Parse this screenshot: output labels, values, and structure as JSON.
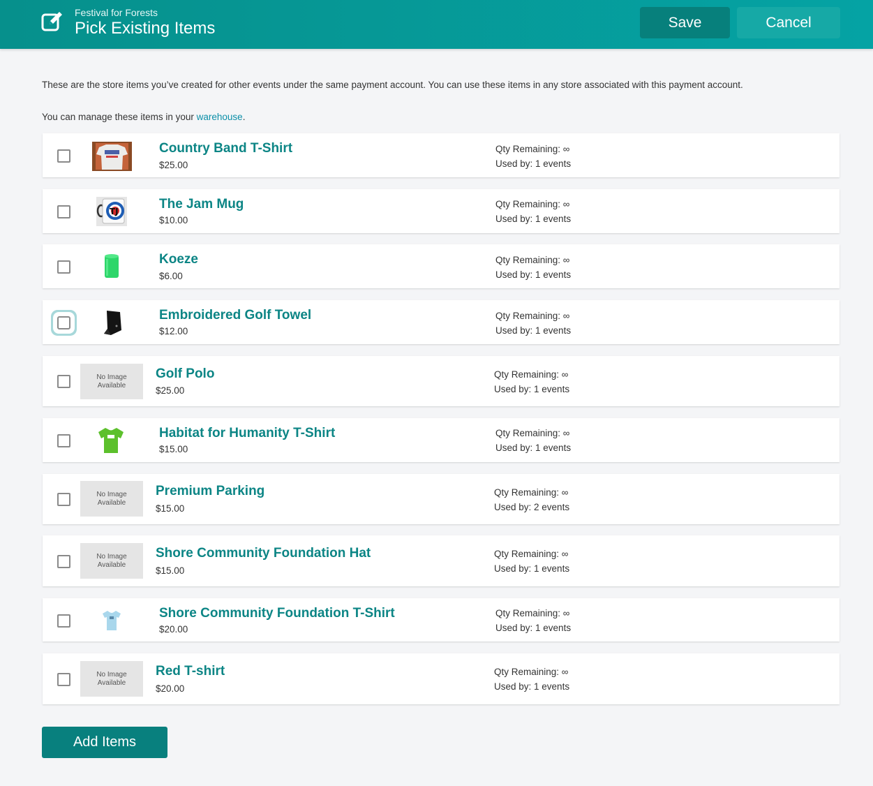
{
  "header": {
    "subtitle": "Festival for Forests",
    "title": "Pick Existing Items",
    "save_label": "Save",
    "cancel_label": "Cancel",
    "icon": "edit-icon"
  },
  "intro": {
    "description": "These are the store items you’ve created for other events under the same payment account. You can use these items in any store associated with this payment account.",
    "manage_prefix": "You can manage these items in your ",
    "manage_link": "warehouse",
    "manage_suffix": "."
  },
  "no_image": {
    "line1": "No Image",
    "line2": "Available"
  },
  "qty_label": "Qty Remaining: ",
  "used_label": "Used by: ",
  "items": [
    {
      "name": "Country Band T-Shirt",
      "price": "$25.00",
      "qty": "∞",
      "used": "1 events",
      "image": "photo"
    },
    {
      "name": "The Jam Mug",
      "price": "$10.00",
      "qty": "∞",
      "used": "1 events",
      "image": "photo"
    },
    {
      "name": "Koeze",
      "price": "$6.00",
      "qty": "∞",
      "used": "1 events",
      "image": "photo"
    },
    {
      "name": "Embroidered Golf Towel",
      "price": "$12.00",
      "qty": "∞",
      "used": "1 events",
      "image": "photo"
    },
    {
      "name": "Golf Polo",
      "price": "$25.00",
      "qty": "∞",
      "used": "1 events",
      "image": "none"
    },
    {
      "name": "Habitat for Humanity T-Shirt",
      "price": "$15.00",
      "qty": "∞",
      "used": "1 events",
      "image": "photo"
    },
    {
      "name": "Premium Parking",
      "price": "$15.00",
      "qty": "∞",
      "used": "2 events",
      "image": "none"
    },
    {
      "name": "Shore Community Foundation Hat",
      "price": "$15.00",
      "qty": "∞",
      "used": "1 events",
      "image": "none"
    },
    {
      "name": "Shore Community Foundation T-Shirt",
      "price": "$20.00",
      "qty": "∞",
      "used": "1 events",
      "image": "photo"
    },
    {
      "name": "Red T-shirt",
      "price": "$20.00",
      "qty": "∞",
      "used": "1 events",
      "image": "none"
    }
  ],
  "add_button_label": "Add Items"
}
